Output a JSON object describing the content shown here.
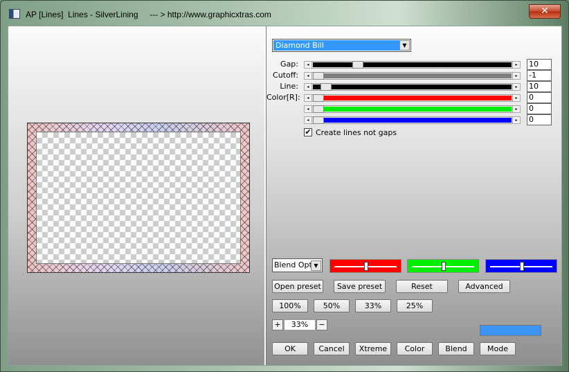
{
  "window": {
    "title": "AP [Lines]  Lines - SilverLining     --- > http://www.graphicxtras.com",
    "close_glyph": "✕"
  },
  "preset": {
    "selected": "Diamond Bill",
    "arrow": "▼"
  },
  "sliders": [
    {
      "label": "Gap:",
      "value": "10",
      "color": "#000000",
      "level": 0.21
    },
    {
      "label": "Cutoff:",
      "value": "-1",
      "color": "#7f7f7f",
      "level": 0.0
    },
    {
      "label": "Line:",
      "value": "10",
      "color": "#000000",
      "level": 0.04
    },
    {
      "label": "Color[R]:",
      "value": "0",
      "color": "#ff0000",
      "level": 0.0
    },
    {
      "label": "",
      "value": "0",
      "color": "#00ee00",
      "level": 0.0
    },
    {
      "label": "",
      "value": "0",
      "color": "#0000ff",
      "level": 0.0
    }
  ],
  "checkbox": {
    "label": "Create lines not gaps",
    "checked": true,
    "mark": "✔"
  },
  "blend": {
    "select_label": "Blend Options",
    "bars": [
      {
        "name": "red",
        "color": "#ff0000",
        "level": 0.5
      },
      {
        "name": "green",
        "color": "#00ee00",
        "level": 0.5
      },
      {
        "name": "blue",
        "color": "#0000ff",
        "level": 0.5
      }
    ]
  },
  "buttons": {
    "open_preset": "Open preset",
    "save_preset": "Save preset",
    "reset": "Reset",
    "advanced": "Advanced",
    "zoom_100": "100%",
    "zoom_50": "50%",
    "zoom_33": "33%",
    "zoom_25": "25%",
    "ok": "OK",
    "cancel": "Cancel",
    "xtreme": "Xtreme",
    "color": "Color",
    "blend": "Blend",
    "mode": "Mode"
  },
  "zoom": {
    "plus": "+",
    "value": "33%",
    "minus": "−"
  },
  "swatch_color": "#3d95f3",
  "arrows": {
    "left": "◂",
    "right": "▸"
  }
}
